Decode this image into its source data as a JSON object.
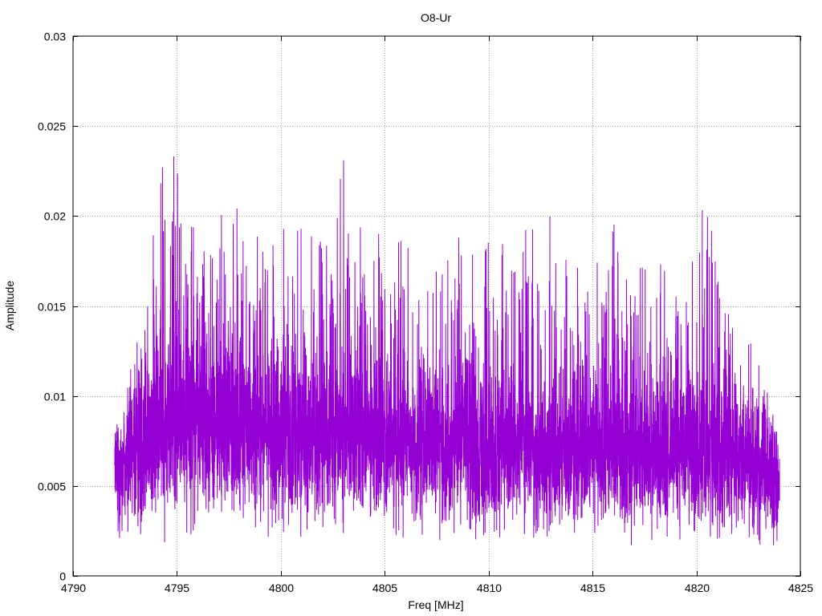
{
  "chart_data": {
    "type": "line",
    "title": "O8-Ur",
    "xlabel": "Freq [MHz]",
    "ylabel": "Amplitude",
    "xlim": [
      4790,
      4825
    ],
    "ylim": [
      0,
      0.03
    ],
    "xticks": [
      4790,
      4795,
      4800,
      4805,
      4810,
      4815,
      4820,
      4825
    ],
    "yticks": [
      0,
      0.005,
      0.01,
      0.015,
      0.02,
      0.025,
      0.03
    ],
    "ytick_labels": [
      "0",
      "0.005",
      "0.01",
      "0.015",
      "0.02",
      "0.025",
      "0.03"
    ],
    "grid": true,
    "legend": "none",
    "line_color": "#9400d3",
    "x_range_of_data": [
      4792.0,
      4824.0
    ],
    "series": [
      {
        "x": [
          4792.0,
          4792.5,
          4793.0,
          4793.5,
          4794.0,
          4794.5,
          4795.0,
          4795.5,
          4796.0,
          4796.5,
          4797.0,
          4797.5,
          4798.0,
          4798.5,
          4799.0,
          4799.5,
          4800.0,
          4800.5,
          4801.0,
          4801.5,
          4802.0,
          4802.5,
          4803.0,
          4803.5,
          4804.0,
          4804.5,
          4805.0,
          4805.5,
          4806.0,
          4806.5,
          4807.0,
          4807.5,
          4808.0,
          4808.5,
          4809.0,
          4809.5,
          4810.0,
          4810.5,
          4811.0,
          4811.5,
          4812.0,
          4812.5,
          4813.0,
          4813.5,
          4814.0,
          4814.5,
          4815.0,
          4815.5,
          4816.0,
          4816.5,
          4817.0,
          4817.5,
          4818.0,
          4818.5,
          4819.0,
          4819.5,
          4820.0,
          4820.5,
          4821.0,
          4821.5,
          4822.0,
          4822.5,
          4823.0,
          4823.5,
          4824.0
        ],
        "peak_envelope": [
          0.0078,
          0.0105,
          0.0123,
          0.0165,
          0.0265,
          0.022,
          0.0256,
          0.022,
          0.0185,
          0.021,
          0.0226,
          0.018,
          0.0226,
          0.0195,
          0.0205,
          0.019,
          0.0208,
          0.018,
          0.0205,
          0.0195,
          0.0185,
          0.0205,
          0.0243,
          0.019,
          0.021,
          0.0205,
          0.017,
          0.0185,
          0.021,
          0.0185,
          0.019,
          0.0175,
          0.0182,
          0.019,
          0.018,
          0.02,
          0.0185,
          0.0175,
          0.0209,
          0.018,
          0.0205,
          0.0175,
          0.0205,
          0.019,
          0.0185,
          0.017,
          0.018,
          0.0175,
          0.02,
          0.0165,
          0.0185,
          0.017,
          0.0175,
          0.0175,
          0.016,
          0.0185,
          0.0175,
          0.0229,
          0.0165,
          0.015,
          0.014,
          0.0135,
          0.0135,
          0.0095,
          0.008
        ],
        "typical_level": [
          0.0055,
          0.0062,
          0.0068,
          0.0075,
          0.0082,
          0.0085,
          0.0088,
          0.0087,
          0.0085,
          0.0083,
          0.008,
          0.008,
          0.008,
          0.0078,
          0.0078,
          0.0076,
          0.0076,
          0.0075,
          0.0075,
          0.0074,
          0.0074,
          0.0074,
          0.0075,
          0.0075,
          0.0076,
          0.0074,
          0.0072,
          0.0072,
          0.0072,
          0.0071,
          0.0071,
          0.007,
          0.007,
          0.007,
          0.0069,
          0.0069,
          0.0068,
          0.0068,
          0.0068,
          0.0068,
          0.0068,
          0.0068,
          0.0068,
          0.0068,
          0.0068,
          0.0068,
          0.0068,
          0.0067,
          0.0067,
          0.0067,
          0.0067,
          0.0066,
          0.0066,
          0.0066,
          0.0066,
          0.0066,
          0.0066,
          0.0066,
          0.0065,
          0.0064,
          0.0062,
          0.006,
          0.0058,
          0.0055,
          0.005
        ]
      }
    ]
  }
}
